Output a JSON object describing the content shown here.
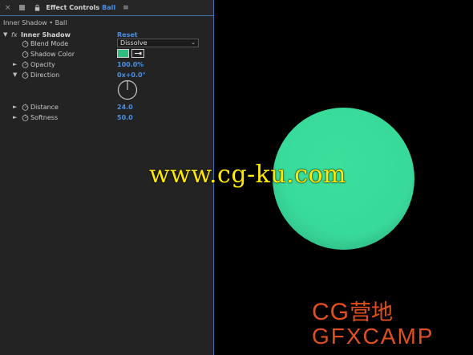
{
  "panel": {
    "tab_close": "×",
    "tab_title": "Effect Controls",
    "tab_layer": "Ball",
    "tab_menu": "≡",
    "subheader": "Inner Shadow • Ball"
  },
  "effect": {
    "twirl": "▼",
    "fx": "fx",
    "name": "Inner Shadow",
    "reset": "Reset",
    "properties": {
      "blend_mode": {
        "label": "Blend Mode",
        "value": "Dissolve"
      },
      "shadow_color": {
        "label": "Shadow Color",
        "color": "#2fbd80"
      },
      "opacity": {
        "twirl": "►",
        "label": "Opacity",
        "value": "100.0%"
      },
      "direction": {
        "twirl": "▼",
        "label": "Direction",
        "value": "0x+0.0°"
      },
      "distance": {
        "twirl": "►",
        "label": "Distance",
        "value": "24.0"
      },
      "softness": {
        "twirl": "►",
        "label": "Softness",
        "value": "50.0"
      }
    }
  },
  "viewer": {
    "ball_color": "#38d99a",
    "watermark_url": "www.cg-ku.com",
    "logo_line1_latin": "CG",
    "logo_line1_cn": "营地",
    "logo_line2": "GFXCAMP",
    "logo_color": "#e0501e"
  },
  "colors": {
    "accent_blue": "#4a90e2",
    "panel_bg": "#232323",
    "watermark_yellow": "#ffea00"
  }
}
